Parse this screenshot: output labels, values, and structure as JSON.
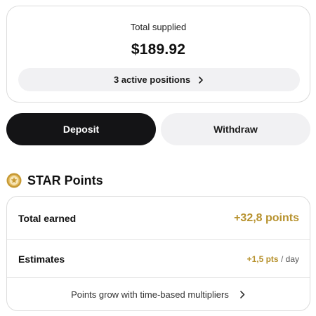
{
  "supplied": {
    "label": "Total supplied",
    "value": "$189.92",
    "positions_label": "3 active positions"
  },
  "actions": {
    "deposit_label": "Deposit",
    "withdraw_label": "Withdraw"
  },
  "points": {
    "title": "STAR Points",
    "total_earned_label": "Total earned",
    "total_earned_value": "+32,8 points",
    "estimates_label": "Estimates",
    "estimates_value": "+1,5 pts",
    "estimates_separator": "/",
    "estimates_unit": "day",
    "footer_text": "Points grow with time-based multipliers"
  },
  "icons": {
    "star_badge": "star-badge-icon",
    "chevron": "chevron-right-icon"
  },
  "colors": {
    "accent_gold": "#b7922e",
    "primary_button": "#141416",
    "secondary_button": "#f1f1f3"
  }
}
